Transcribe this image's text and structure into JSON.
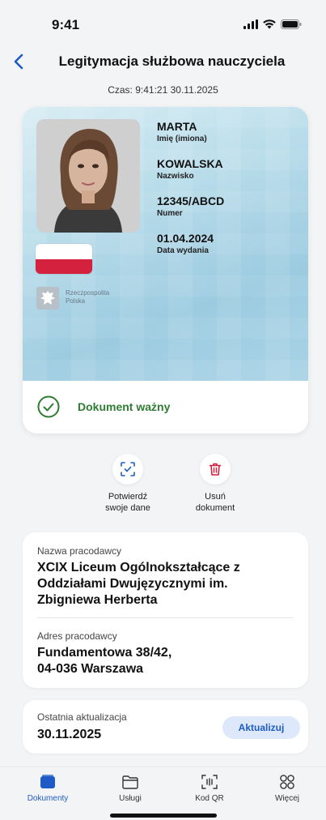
{
  "status_bar": {
    "time": "9:41"
  },
  "header": {
    "title": "Legitymacja służbowa nauczyciela",
    "back_icon": "chevron-left-icon"
  },
  "timestamp": "Czas: 9:41:21 30.11.2025",
  "card": {
    "first_name": {
      "value": "MARTA",
      "label": "Imię (imiona)"
    },
    "last_name": {
      "value": "KOWALSKA",
      "label": "Nazwisko"
    },
    "number": {
      "value": "12345/ABCD",
      "label": "Numer"
    },
    "issue_date": {
      "value": "01.04.2024",
      "label": "Data wydania"
    },
    "emblem_text_line1": "Rzeczpospolita",
    "emblem_text_line2": "Polska",
    "status_text": "Dokument ważny",
    "status_color": "#2e7d32",
    "flag_colors": {
      "top": "#ffffff",
      "bottom": "#d4213d"
    }
  },
  "actions": [
    {
      "label": "Potwierdź\nswoje dane",
      "icon": "scan-check-icon"
    },
    {
      "label": "Usuń\ndokument",
      "icon": "trash-icon"
    }
  ],
  "employer": {
    "name_label": "Nazwa pracodawcy",
    "name_value": "XCIX Liceum Ogólnokształcące z Oddziałami Dwujęzycznymi im. Zbigniewa Herberta",
    "address_label": "Adres pracodawcy",
    "address_line1": "Fundamentowa 38/42,",
    "address_line2": "04-036 Warszawa"
  },
  "update": {
    "label": "Ostatnia aktualizacja",
    "date": "30.11.2025",
    "button": "Aktualizuj"
  },
  "tabs": [
    {
      "label": "Dokumenty",
      "icon": "wallet-icon",
      "active": true
    },
    {
      "label": "Usługi",
      "icon": "folder-icon",
      "active": false
    },
    {
      "label": "Kod QR",
      "icon": "qr-scan-icon",
      "active": false
    },
    {
      "label": "Więcej",
      "icon": "grid-icon",
      "active": false
    }
  ],
  "colors": {
    "accent": "#1e5bc6",
    "background": "#f3f4f6"
  }
}
